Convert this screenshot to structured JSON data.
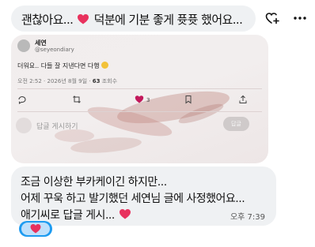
{
  "top_message": {
    "text_before": "괜찮아요...",
    "text_after": "덕분에 기분 좋게 퓻퓻 했어요..."
  },
  "icons": {
    "react": "add-reaction-icon",
    "more": "more-icon",
    "heart": "heart-emoji-icon"
  },
  "shared_post": {
    "name": "세연",
    "handle": "@seyeondiary",
    "body": "더워요.. 다들 잘 지낸다면 다행",
    "time": "오전 2:52",
    "date": "2026년 8월 9일",
    "views_count": "63",
    "views_label": "조회수",
    "likes": "3",
    "reply_placeholder": "답글 게시하기",
    "reply_button": "답글"
  },
  "message": {
    "line1": "조금 이상한 부카케이긴 하지만...",
    "line2": "어제 꾸욱 하고 발기했던 세연님 글에 사정했어요...",
    "line3": "애기씨로 답글 게시...",
    "time": "오후 7:39"
  },
  "reaction": {
    "emoji": "heart-emoji-icon"
  },
  "colors": {
    "bubble": "#eff1f3",
    "heart": "#e8325e",
    "reaction_pill": "#1d9bf0"
  }
}
